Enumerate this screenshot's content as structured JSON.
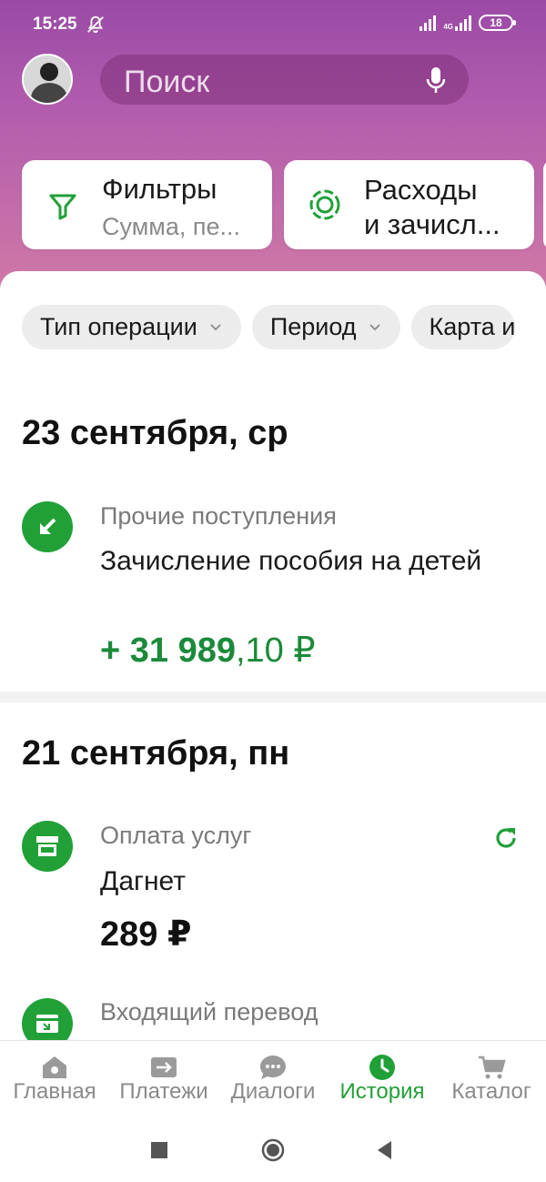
{
  "status_bar": {
    "time": "15:25",
    "network": "4G",
    "battery": "18",
    "icons": [
      "bell-muted-icon",
      "signal-icon",
      "signal-4g-icon",
      "battery-icon"
    ]
  },
  "header": {
    "search_placeholder": "Поиск",
    "icons": [
      "avatar",
      "mic-icon"
    ]
  },
  "cards": [
    {
      "title": "Фильтры",
      "subtitle": "Сумма, пе...",
      "icon": "filter-icon"
    },
    {
      "title_line1": "Расходы",
      "title_line2": "и зачисл...",
      "icon": "ring-chart-icon"
    }
  ],
  "chips": [
    {
      "label": "Тип операции"
    },
    {
      "label": "Период"
    },
    {
      "label": "Карта и"
    }
  ],
  "groups": [
    {
      "date": "23 сентября, ср",
      "transactions": [
        {
          "category": "Прочие поступления",
          "title": "Зачисление пособия на детей",
          "amount_sign": "+ ",
          "amount_int": "31 989",
          "amount_dec": ",10 ₽",
          "icon": "arrow-in-icon"
        }
      ]
    },
    {
      "date": "21 сентября, пн",
      "transactions": [
        {
          "category": "Оплата услуг",
          "title": "Дагнет",
          "amount": "289 ₽",
          "icon": "store-icon",
          "action_icon": "repeat-icon"
        },
        {
          "category": "Входящий перевод",
          "icon": "card-transfer-icon"
        }
      ]
    }
  ],
  "bottom_nav": [
    {
      "label": "Главная",
      "icon": "home-icon",
      "active": false
    },
    {
      "label": "Платежи",
      "icon": "payments-icon",
      "active": false
    },
    {
      "label": "Диалоги",
      "icon": "dialogs-icon",
      "active": false
    },
    {
      "label": "История",
      "icon": "history-icon",
      "active": true
    },
    {
      "label": "Каталог",
      "icon": "cart-icon",
      "active": false
    }
  ],
  "colors": {
    "accent_green": "#21a038",
    "amount_green": "#1b8a3a",
    "header_gradient_top": "#9a4aa6",
    "header_gradient_bottom": "#d07aa6"
  }
}
